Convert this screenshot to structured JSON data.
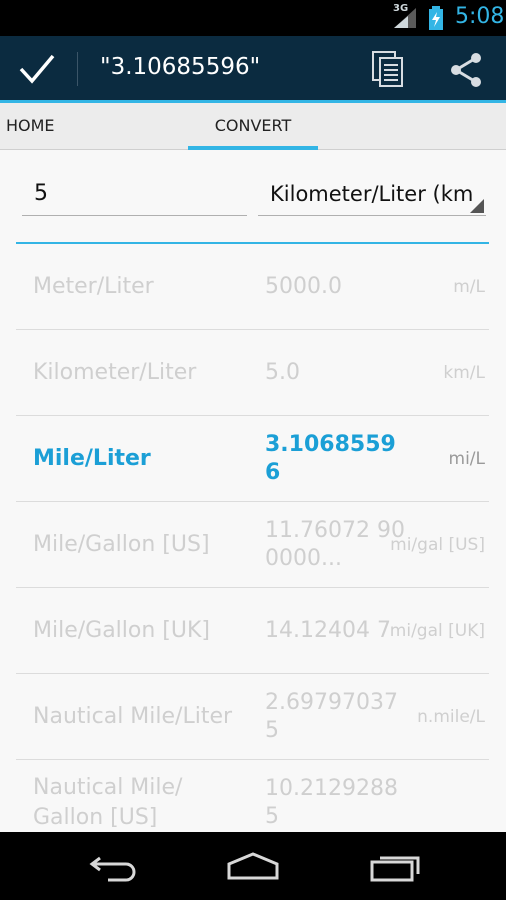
{
  "status_bar": {
    "network": "3G",
    "time": "5:08",
    "icons": [
      "signal-icon",
      "battery-charging-icon"
    ]
  },
  "action_bar": {
    "title": "\"3.10685596\"",
    "icons": [
      "check-icon",
      "copy-icon",
      "share-icon"
    ]
  },
  "tabs": [
    {
      "label": "HOME"
    },
    {
      "label": "CONVERT",
      "selected": true
    }
  ],
  "converter": {
    "input_value": "5",
    "selected_unit": "Kilometer/Liter (km"
  },
  "results": [
    {
      "name": "Meter/Liter",
      "value": "5000.0",
      "unit": "m/L"
    },
    {
      "name": "Kilometer/Liter",
      "value": "5.0",
      "unit": "km/L"
    },
    {
      "name": "Mile/Liter",
      "value": "3.10685596",
      "unit": "mi/L",
      "active": true
    },
    {
      "name": "Mile/Gallon [US]",
      "value": "11.76072 900000...",
      "unit": "mi/gal [US]"
    },
    {
      "name": "Mile/Gallon [UK]",
      "value": "14.12404 7",
      "unit": "mi/gal [UK]"
    },
    {
      "name": "Nautical Mile/Liter",
      "value": "2.69797037 5",
      "unit": "n.mile/L"
    },
    {
      "name": "Nautical Mile/ Gallon [US]",
      "value": "10.21292885",
      "unit": ""
    }
  ],
  "colors": {
    "accent": "#33b5e5",
    "active_text": "#1b9fd6",
    "action_bar": "#0b2b40"
  },
  "nav_bar": {
    "icons": [
      "back-icon",
      "home-icon",
      "recent-apps-icon"
    ]
  }
}
